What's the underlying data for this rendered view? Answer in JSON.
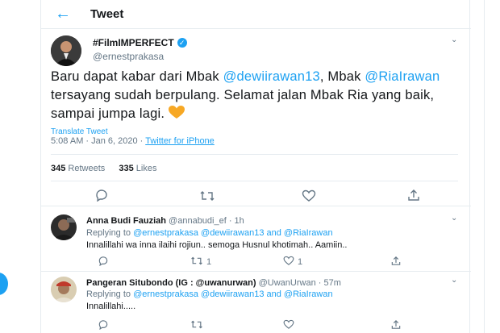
{
  "header": {
    "title": "Tweet"
  },
  "tweet": {
    "display_name": "#FilmIMPERFECT",
    "handle": "@ernestprakasa",
    "text_1": "Baru dapat kabar dari Mbak ",
    "mention_1": "@dewiirawan13",
    "text_2": ", Mbak ",
    "mention_2": "@RiaIrawan",
    "text_3": " tersayang sudah berpulang. Selamat jalan Mbak Ria yang baik, sampai jumpa lagi.",
    "translate_label": "Translate Tweet",
    "timestamp": "5:08 AM · Jan 6, 2020 · ",
    "source": "Twitter for iPhone",
    "retweets_count": "345",
    "retweets_label": " Retweets",
    "likes_count": "335",
    "likes_label": " Likes"
  },
  "replies": [
    {
      "name": "Anna Budi Fauziah",
      "meta": " @annabudi_ef · 1h",
      "replying_prefix": "Replying to ",
      "replying_mentions": "@ernestprakasa @dewiirawan13 and @RiaIrawan",
      "text": "Innalillahi wa inna ilaihi rojiun.. semoga Husnul khotimah.. Aamiin..",
      "retweet_count": "1",
      "like_count": "1"
    },
    {
      "name": "Pangeran Situbondo (IG : @uwanurwan)",
      "meta": " @UwanUrwan · 57m",
      "replying_prefix": "Replying to ",
      "replying_mentions": "@ernestprakasa @dewiirawan13 and @RiaIrawan",
      "text": "Innalillahi....."
    }
  ],
  "icons": [
    "back-arrow-icon",
    "verified-badge-icon",
    "chevron-down-icon",
    "reply-icon",
    "retweet-icon",
    "like-icon",
    "share-icon",
    "orange-heart-emoji-icon"
  ],
  "colors": {
    "accent": "#1da1f2",
    "muted": "#657786",
    "text": "#14171a",
    "border": "#e6ecf0",
    "heart": "#f7a824"
  }
}
